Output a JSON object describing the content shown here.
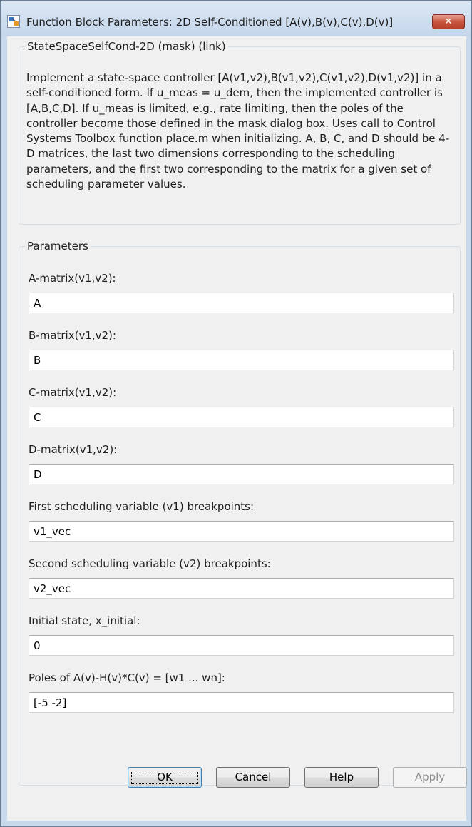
{
  "window": {
    "title": "Function Block Parameters: 2D Self-Conditioned [A(v),B(v),C(v),D(v)]",
    "close_label": "✕"
  },
  "description": {
    "legend": "StateSpaceSelfCond-2D (mask) (link)",
    "text": "Implement a state-space controller [A(v1,v2),B(v1,v2),C(v1,v2),D(v1,v2)] in a self-conditioned form. If u_meas = u_dem, then the implemented controller is [A,B,C,D]. If u_meas is limited, e.g., rate limiting, then the poles of the controller become those defined in the mask dialog box. Uses call to Control Systems Toolbox function place.m when initializing. A, B, C, and D should be 4-D matrices, the last two dimensions corresponding to the scheduling parameters, and the first two corresponding to the matrix for a given set of scheduling parameter values."
  },
  "parameters": {
    "legend": "Parameters",
    "fields": [
      {
        "label": "A-matrix(v1,v2):",
        "value": "A"
      },
      {
        "label": "B-matrix(v1,v2):",
        "value": "B"
      },
      {
        "label": "C-matrix(v1,v2):",
        "value": "C"
      },
      {
        "label": "D-matrix(v1,v2):",
        "value": "D"
      },
      {
        "label": "First scheduling variable (v1) breakpoints:",
        "value": "v1_vec"
      },
      {
        "label": "Second scheduling variable (v2) breakpoints:",
        "value": "v2_vec"
      },
      {
        "label": "Initial state, x_initial:",
        "value": "0"
      },
      {
        "label": "Poles of A(v)-H(v)*C(v) = [w1 ... wn]:",
        "value": "[-5 -2]"
      }
    ]
  },
  "buttons": {
    "ok": "OK",
    "cancel": "Cancel",
    "help": "Help",
    "apply": "Apply"
  },
  "colors": {
    "frame": "#c9d9ec",
    "client": "#f0f0f0",
    "close_button": "#c75540",
    "default_button_border": "#3c7fb1"
  }
}
